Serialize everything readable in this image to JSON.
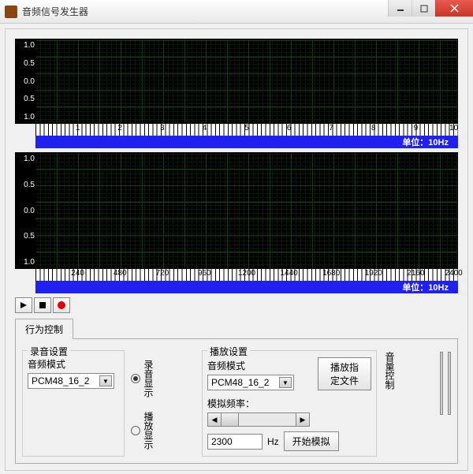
{
  "window": {
    "title": "音频信号发生器"
  },
  "plot1": {
    "yticks": [
      "1.0",
      "0.5",
      "0.0",
      "0.5",
      "1.0"
    ],
    "xticks": [
      "1",
      "2",
      "3",
      "4",
      "5",
      "6",
      "7",
      "8",
      "9",
      "10"
    ],
    "unit_label": "单位：10Hz"
  },
  "plot2": {
    "yticks": [
      "1.0",
      "0.5",
      "0.0",
      "0.5",
      "1.0"
    ],
    "xticks": [
      "240",
      "480",
      "720",
      "960",
      "1200",
      "1440",
      "1680",
      "1920",
      "2160",
      "2400"
    ],
    "unit_label": "单位：10Hz"
  },
  "tab": {
    "behavior": "行为控制"
  },
  "record_group": {
    "title": "录音设置",
    "mode_label": "音频模式",
    "mode_value": "PCM48_16_2"
  },
  "display_mode": {
    "record": "录音显示",
    "play": "播放显示"
  },
  "play_group": {
    "title": "播放设置",
    "mode_label": "音频模式",
    "mode_value": "PCM48_16_2",
    "play_file_btn": "播放指定文件",
    "sim_freq_label": "模拟频率：",
    "sim_freq_value": "2300",
    "hz": "Hz",
    "start_sim_btn": "开始模拟"
  },
  "volume": {
    "label": "音量控制"
  }
}
